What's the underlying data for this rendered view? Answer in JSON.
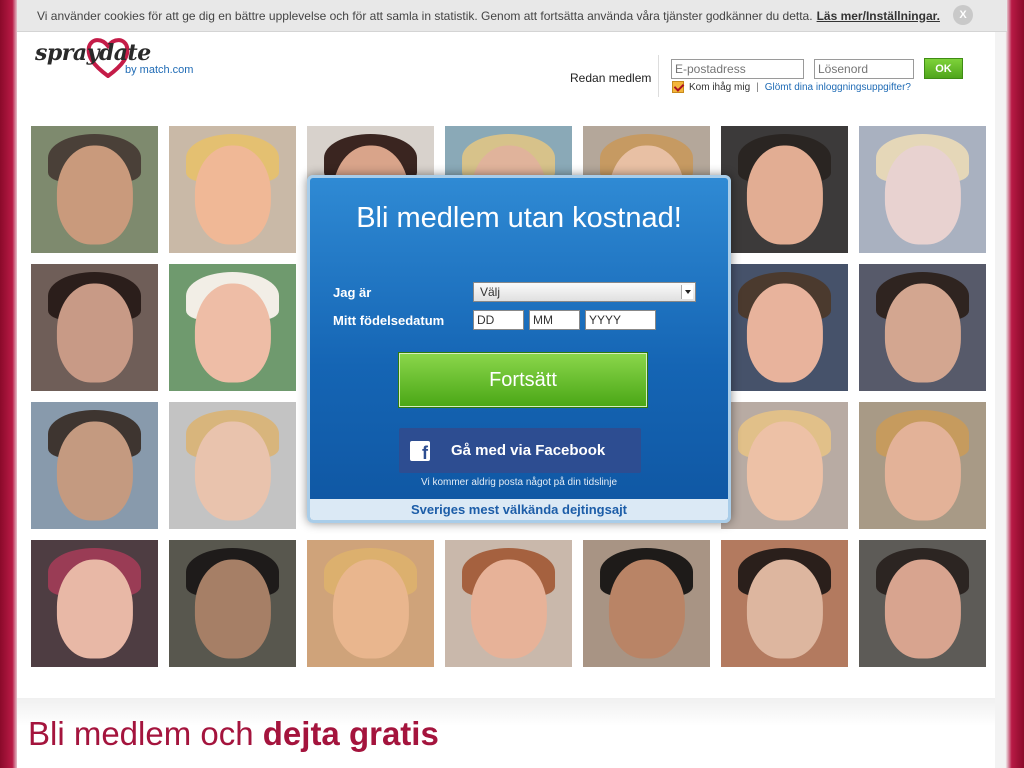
{
  "cookie": {
    "message": "Vi använder cookies för att ge dig en bättre upplevelse och för att samla in statistik. Genom att fortsätta använda våra tjänster godkänner du detta.",
    "link": "Läs mer/Inställningar.",
    "close": "X"
  },
  "logo": {
    "name": "spraydate",
    "sub": "by match.com"
  },
  "login": {
    "label": "Redan medlem",
    "email_placeholder": "E-postadress",
    "password_placeholder": "Lösenord",
    "ok": "OK",
    "remember": "Kom ihåg mig",
    "divider": "|",
    "forgot": "Glömt dina inloggningsuppgifter?"
  },
  "signup": {
    "title": "Bli medlem utan kostnad!",
    "gender_label": "Jag är",
    "gender_value": "Välj",
    "birth_label": "Mitt födelsedatum",
    "dd": "DD",
    "mm": "MM",
    "yyyy": "YYYY",
    "continue": "Fortsätt",
    "facebook": "Gå med via Facebook",
    "facebook_icon": "f",
    "facebook_note": "Vi kommer aldrig posta något på din tidslinje",
    "footer": "Sveriges mest välkända dejtingsajt"
  },
  "bottom": {
    "title_normal": "Bli medlem och",
    "title_bold": "dejta gratis"
  },
  "colors": {
    "brand": "#a4143d",
    "modal_blue": "#1565b4",
    "button_green": "#4ba717",
    "facebook_blue": "#2d4d91"
  },
  "photos": [
    {
      "bg": "#7e8a6e",
      "skin": "#c99a7c",
      "hair": "#4a4038"
    },
    {
      "bg": "#c9b9a7",
      "skin": "#f0b896",
      "hair": "#e4c071"
    },
    {
      "bg": "#d8d2cc",
      "skin": "#d9a48a",
      "hair": "#3a2520"
    },
    {
      "bg": "#8aa9b7",
      "skin": "#e0b39b",
      "hair": "#d7c28a"
    },
    {
      "bg": "#b4a79a",
      "skin": "#e8c0a4",
      "hair": "#c69a62"
    },
    {
      "bg": "#3c3a3a",
      "skin": "#e2ad93",
      "hair": "#2a2522"
    },
    {
      "bg": "#a9b1c0",
      "skin": "#e8d2d0",
      "hair": "#e5d7b8"
    },
    {
      "bg": "#6f5e58",
      "skin": "#c89a86",
      "hair": "#2b1e1b"
    },
    {
      "bg": "#6f9a6e",
      "skin": "#eebda6",
      "hair": "#f2eee6"
    },
    {
      "bg": "#46526a",
      "skin": "#e8b39c",
      "hair": "#4b3a2e"
    },
    {
      "bg": "#575a6a",
      "skin": "#d3a690",
      "hair": "#2f2420"
    },
    {
      "bg": "#889aac",
      "skin": "#c49a80",
      "hair": "#3e3530"
    },
    {
      "bg": "#c3c3c3",
      "skin": "#e9c3ad",
      "hair": "#d8b57c"
    },
    {
      "bg": "#b8aba3",
      "skin": "#edc1a6",
      "hair": "#e1c089"
    },
    {
      "bg": "#a89a86",
      "skin": "#e3b298",
      "hair": "#c69b5e"
    },
    {
      "bg": "#4e3d42",
      "skin": "#e8b8a6",
      "hair": "#9a3c55"
    },
    {
      "bg": "#58574e",
      "skin": "#a67f66",
      "hair": "#1e1b1a"
    },
    {
      "bg": "#cfa37a",
      "skin": "#e9b68e",
      "hair": "#dcb06e"
    },
    {
      "bg": "#c9b8ab",
      "skin": "#e7b298",
      "hair": "#a5613f"
    },
    {
      "bg": "#a89484",
      "skin": "#b98466",
      "hair": "#1e1b19"
    },
    {
      "bg": "#b37a5f",
      "skin": "#ddb69f",
      "hair": "#2a1f1b"
    },
    {
      "bg": "#5d5b57",
      "skin": "#d8a48f",
      "hair": "#2c2522"
    },
    {
      "bg": "#7a8d95",
      "skin": "#e2b49a",
      "hair": "#b39560"
    }
  ]
}
